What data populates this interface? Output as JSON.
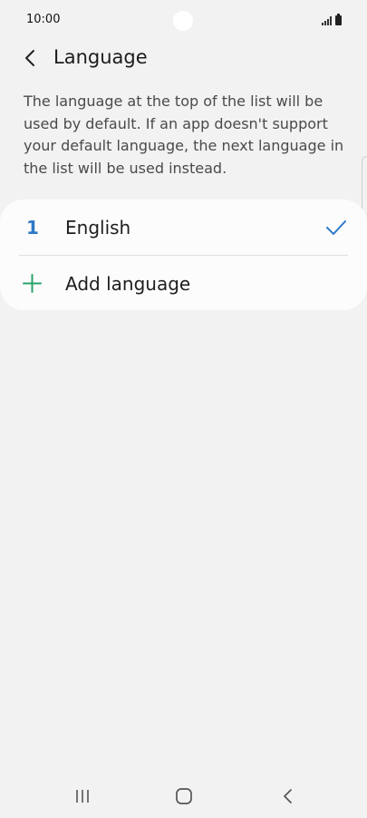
{
  "status_bar": {
    "time": "10:00"
  },
  "header": {
    "title": "Language"
  },
  "description": "The language at the top of the list will be used by default. If an app doesn't support your default language, the next language in the list will be used instead.",
  "languages": [
    {
      "index": "1",
      "name": "English",
      "selected": true
    }
  ],
  "add_language": {
    "label": "Add language"
  },
  "colors": {
    "background": "#f2f2f2",
    "card": "#fcfcfc",
    "accent_blue": "#2e79c8",
    "accent_green": "#2aa36a"
  },
  "icons": {
    "back": "chevron-left-icon",
    "check": "check-icon",
    "add": "plus-icon",
    "nav_recents": "recents-icon",
    "nav_home": "home-icon",
    "nav_back": "back-icon"
  }
}
